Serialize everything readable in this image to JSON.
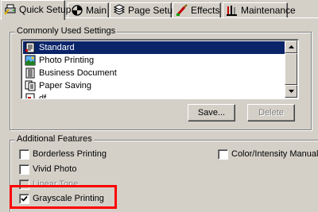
{
  "tabs": [
    {
      "label": "Quick Setup",
      "icon": "printer-quick-icon"
    },
    {
      "label": "Main",
      "icon": "main-swirl-icon"
    },
    {
      "label": "Page Setup",
      "icon": "page-setup-icon"
    },
    {
      "label": "Effects",
      "icon": "effects-brush-icon"
    },
    {
      "label": "Maintenance",
      "icon": "maintenance-tools-icon"
    }
  ],
  "settings_group": {
    "title": "Commonly Used Settings",
    "items": [
      {
        "label": "Standard",
        "selected": true,
        "icon": "document-icon"
      },
      {
        "label": "Photo Printing",
        "selected": false,
        "icon": "photo-icon"
      },
      {
        "label": "Business Document",
        "selected": false,
        "icon": "business-doc-icon"
      },
      {
        "label": "Paper Saving",
        "selected": false,
        "icon": "paper-saving-icon"
      },
      {
        "label": "df",
        "selected": false,
        "icon": "custom-setting-icon"
      }
    ],
    "save_label": "Save...",
    "delete_label": "Delete"
  },
  "features_group": {
    "title": "Additional Features",
    "options": [
      {
        "label": "Borderless Printing",
        "checked": false,
        "enabled": true
      },
      {
        "label": "Color/Intensity Manual Ac",
        "checked": false,
        "enabled": true
      },
      {
        "label": "Vivid Photo",
        "checked": false,
        "enabled": true
      },
      {
        "label": "Linear Tone",
        "checked": false,
        "enabled": false
      },
      {
        "label": "Grayscale Printing",
        "checked": true,
        "enabled": true
      }
    ]
  },
  "colors": {
    "face": "#d4d0c8",
    "selection": "#0a246a",
    "highlight_annotation": "#ff0000"
  }
}
